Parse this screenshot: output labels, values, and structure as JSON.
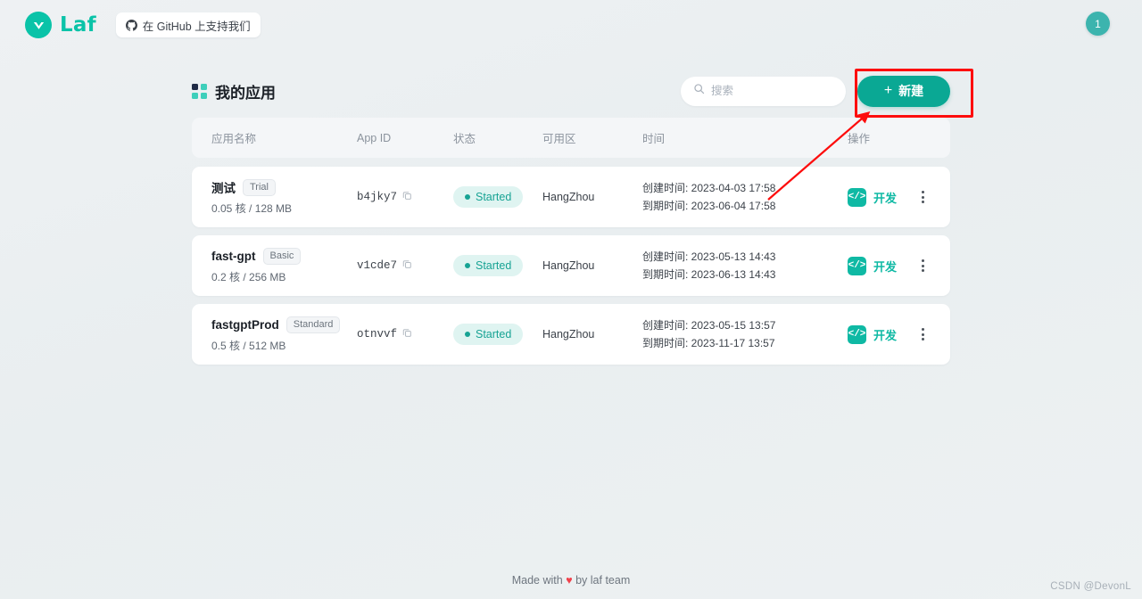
{
  "topbar": {
    "logo_text": "Laf",
    "logo_icon": "laf-logo-icon",
    "github_button": {
      "label": "在 GitHub 上支持我们",
      "icon": "github-icon"
    },
    "avatar_text": "1"
  },
  "page": {
    "title": "我的应用",
    "title_icon": "grid-icon",
    "search": {
      "placeholder": "搜索",
      "value": "",
      "icon": "search-icon"
    },
    "new_button": {
      "label": "新建",
      "icon": "plus-icon"
    }
  },
  "annotation": {
    "rect_color": "#fd0d0d",
    "arrow_color": "#fd0d0d"
  },
  "table": {
    "columns": [
      {
        "key": "name",
        "label": "应用名称"
      },
      {
        "key": "appid",
        "label": "App ID"
      },
      {
        "key": "state",
        "label": "状态"
      },
      {
        "key": "zone",
        "label": "可用区"
      },
      {
        "key": "time",
        "label": "时间"
      },
      {
        "key": "action",
        "label": "操作"
      }
    ],
    "rows": [
      {
        "name": "测试",
        "tier": "Trial",
        "spec": "0.05 核 / 128 MB",
        "appid": "b4jky7",
        "copy_icon": "copy-icon",
        "state": "Started",
        "zone": "HangZhou",
        "created": "创建时间: 2023-04-03 17:58",
        "expires": "到期时间: 2023-06-04 17:58",
        "action_label": "开发",
        "action_icon": "code-icon",
        "menu_icon": "kebab-menu-icon"
      },
      {
        "name": "fast-gpt",
        "tier": "Basic",
        "spec": "0.2 核 / 256 MB",
        "appid": "v1cde7",
        "copy_icon": "copy-icon",
        "state": "Started",
        "zone": "HangZhou",
        "created": "创建时间: 2023-05-13 14:43",
        "expires": "到期时间: 2023-06-13 14:43",
        "action_label": "开发",
        "action_icon": "code-icon",
        "menu_icon": "kebab-menu-icon"
      },
      {
        "name": "fastgptProd",
        "tier": "Standard",
        "spec": "0.5 核 / 512 MB",
        "appid": "otnvvf",
        "copy_icon": "copy-icon",
        "state": "Started",
        "zone": "HangZhou",
        "created": "创建时间: 2023-05-15 13:57",
        "expires": "到期时间: 2023-11-17 13:57",
        "action_label": "开发",
        "action_icon": "code-icon",
        "menu_icon": "kebab-menu-icon"
      }
    ]
  },
  "footer": {
    "prefix": "Made with",
    "heart": "♥",
    "suffix": "by laf team"
  },
  "watermark": "CSDN @DevonL",
  "colors": {
    "brand": "#0ac3a8",
    "accent_button": "#0aa894",
    "status": "#17a394",
    "annotation": "#fd0d0d",
    "background": "#eceff1"
  }
}
